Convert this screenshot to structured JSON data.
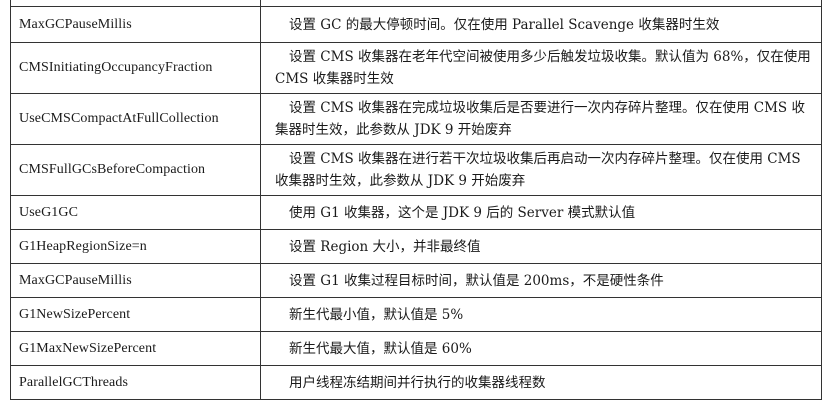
{
  "table": {
    "rows": [
      {
        "param": "MaxGCPauseMillis",
        "desc": "设置 GC 的最大停顿时间。仅在使用 Parallel Scavenge 收集器时生效"
      },
      {
        "param": "CMSInitiatingOccupancyFraction",
        "desc": "设置 CMS 收集器在老年代空间被使用多少后触发垃圾收集。默认值为 68%，仅在使用 CMS 收集器时生效"
      },
      {
        "param": "UseCMSCompactAtFullCollection",
        "desc": "设置 CMS 收集器在完成垃圾收集后是否要进行一次内存碎片整理。仅在使用 CMS 收集器时生效，此参数从 JDK 9 开始废弃"
      },
      {
        "param": "CMSFullGCsBeforeCompaction",
        "desc": "设置 CMS 收集器在进行若干次垃圾收集后再启动一次内存碎片整理。仅在使用 CMS 收集器时生效，此参数从 JDK 9 开始废弃"
      },
      {
        "param": "UseG1GC",
        "desc": "使用 G1 收集器，这个是 JDK 9 后的 Server 模式默认值"
      },
      {
        "param": "G1HeapRegionSize=n",
        "desc": "设置 Region 大小，并非最终值"
      },
      {
        "param": "MaxGCPauseMillis",
        "desc": "设置 G1 收集过程目标时间，默认值是 200ms，不是硬性条件"
      },
      {
        "param": "G1NewSizePercent",
        "desc": "新生代最小值，默认值是 5%"
      },
      {
        "param": "G1MaxNewSizePercent",
        "desc": "新生代最大值，默认值是 60%"
      },
      {
        "param": "ParallelGCThreads",
        "desc": "用户线程冻结期间并行执行的收集器线程数"
      }
    ]
  }
}
